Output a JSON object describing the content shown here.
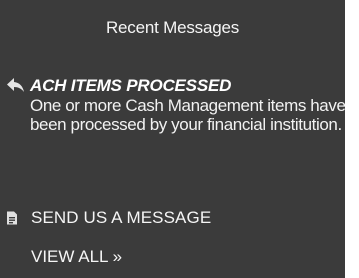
{
  "panel": {
    "title": "Recent Messages",
    "background_color": "#3b3b3b"
  },
  "message": {
    "icon": "reply-arrow-icon",
    "title": "ACH ITEMS PROCESSED",
    "body": "One or more Cash Management items have been processed by your financial institution."
  },
  "actions": {
    "send_icon": "document-icon",
    "send_label": "SEND US A MESSAGE",
    "view_all_label": "VIEW ALL »"
  }
}
